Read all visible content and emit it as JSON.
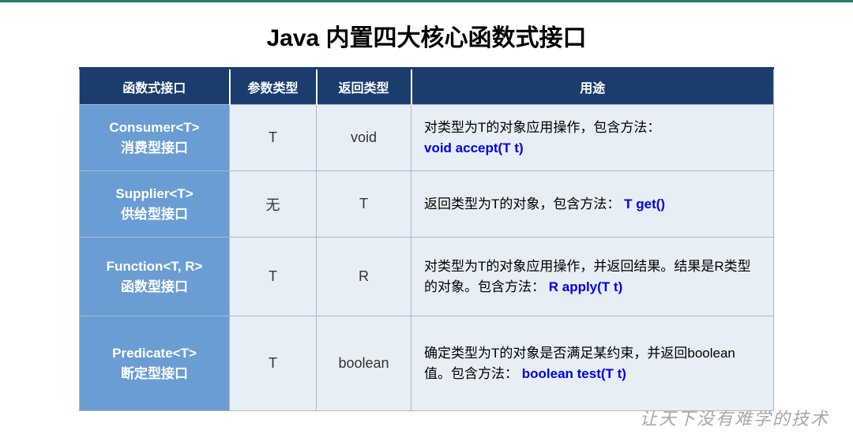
{
  "title": "Java 内置四大核心函数式接口",
  "headers": {
    "col1": "函数式接口",
    "col2": "参数类型",
    "col3": "返回类型",
    "col4": "用途"
  },
  "rows": [
    {
      "iface_name": "Consumer<T>",
      "iface_cn": "消费型接口",
      "param": "T",
      "ret": "void",
      "desc_prefix": "对类型为T的对象应用操作，包含方法：",
      "desc_code": "void accept(T t)"
    },
    {
      "iface_name": "Supplier<T>",
      "iface_cn": "供给型接口",
      "param": "无",
      "ret": "T",
      "desc_prefix": "返回类型为T的对象，包含方法：",
      "desc_code": "T get()"
    },
    {
      "iface_name": "Function<T, R>",
      "iface_cn": "函数型接口",
      "param": "T",
      "ret": "R",
      "desc_prefix": "对类型为T的对象应用操作，并返回结果。结果是R类型的对象。包含方法：",
      "desc_code": "R apply(T t)"
    },
    {
      "iface_name": "Predicate<T>",
      "iface_cn": "断定型接口",
      "param": "T",
      "ret": "boolean",
      "desc_prefix": "确定类型为T的对象是否满足某约束，并返回boolean 值。包含方法：",
      "desc_code": "boolean test(T t)"
    }
  ],
  "watermark": "让天下没有难学的技术"
}
